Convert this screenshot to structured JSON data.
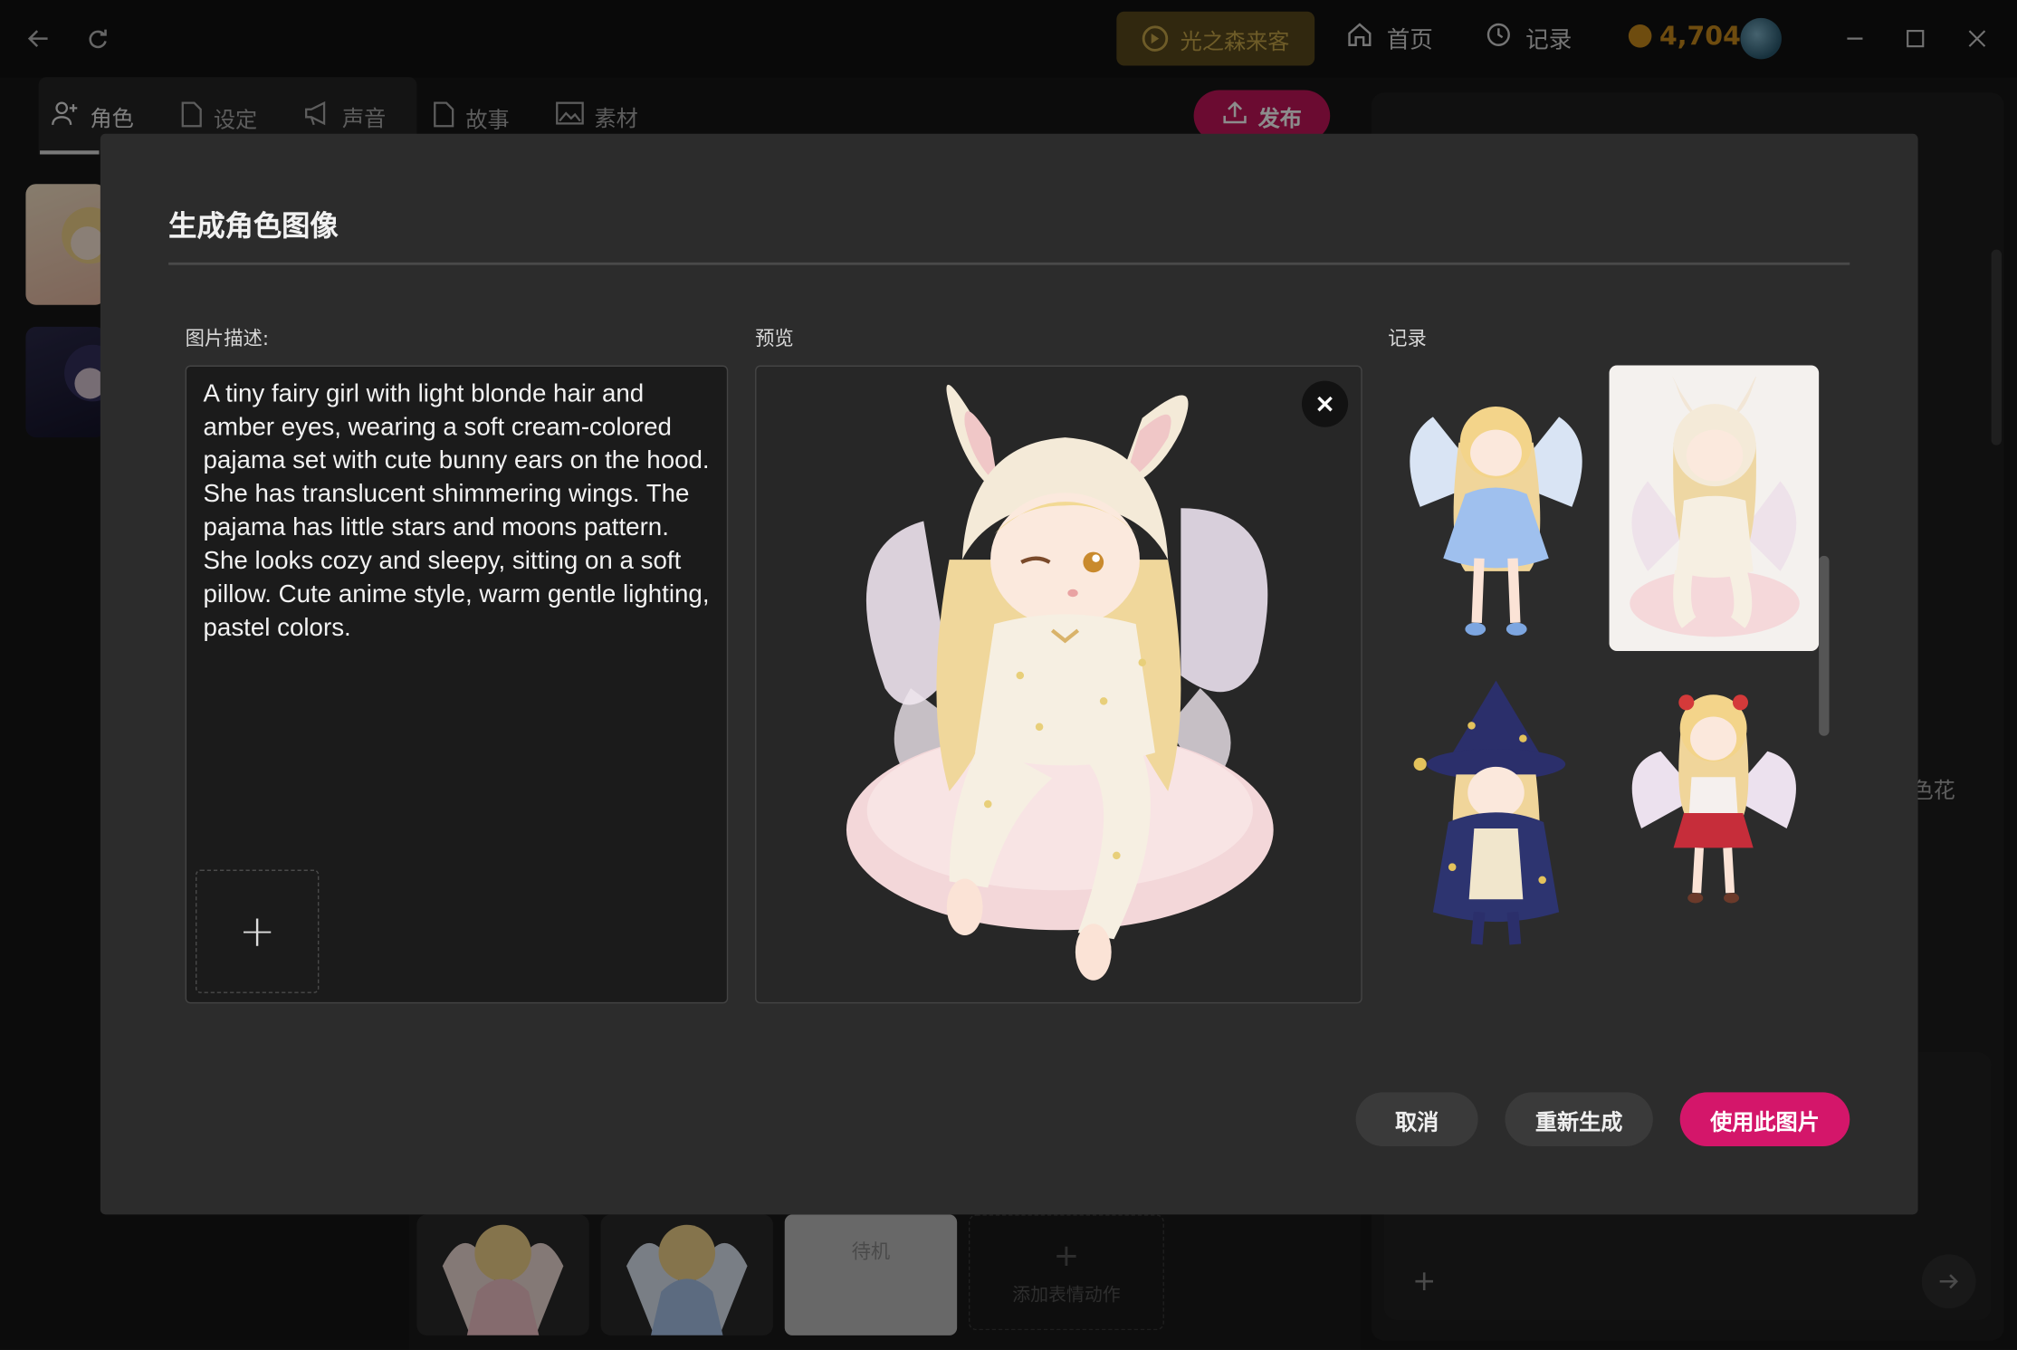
{
  "topbar": {
    "guest_label": "光之森来客",
    "home_label": "首页",
    "history_label": "记录",
    "coins": "4,704"
  },
  "tabs": [
    {
      "label": "角色"
    },
    {
      "label": "设定"
    },
    {
      "label": "声音"
    },
    {
      "label": "故事"
    },
    {
      "label": "素材"
    }
  ],
  "publish_label": "发布",
  "background": {
    "idle_label": "待机",
    "add_motion_label": "添加表情动作",
    "partial_text": "色花"
  },
  "modal": {
    "title": "生成角色图像",
    "desc_label": "图片描述:",
    "preview_label": "预览",
    "history_label": "记录",
    "description": "A tiny fairy girl with light blonde hair and amber eyes, wearing a soft cream-colored pajama set with cute bunny ears on the hood. She has translucent shimmering wings. The pajama has little stars and moons pattern. She looks cozy and sleepy, sitting on a soft pillow. Cute anime style, warm gentle lighting, pastel colors.",
    "cancel_label": "取消",
    "regenerate_label": "重新生成",
    "use_label": "使用此图片"
  },
  "colors": {
    "accent": "#d4166a",
    "gold": "#c98a1d"
  }
}
